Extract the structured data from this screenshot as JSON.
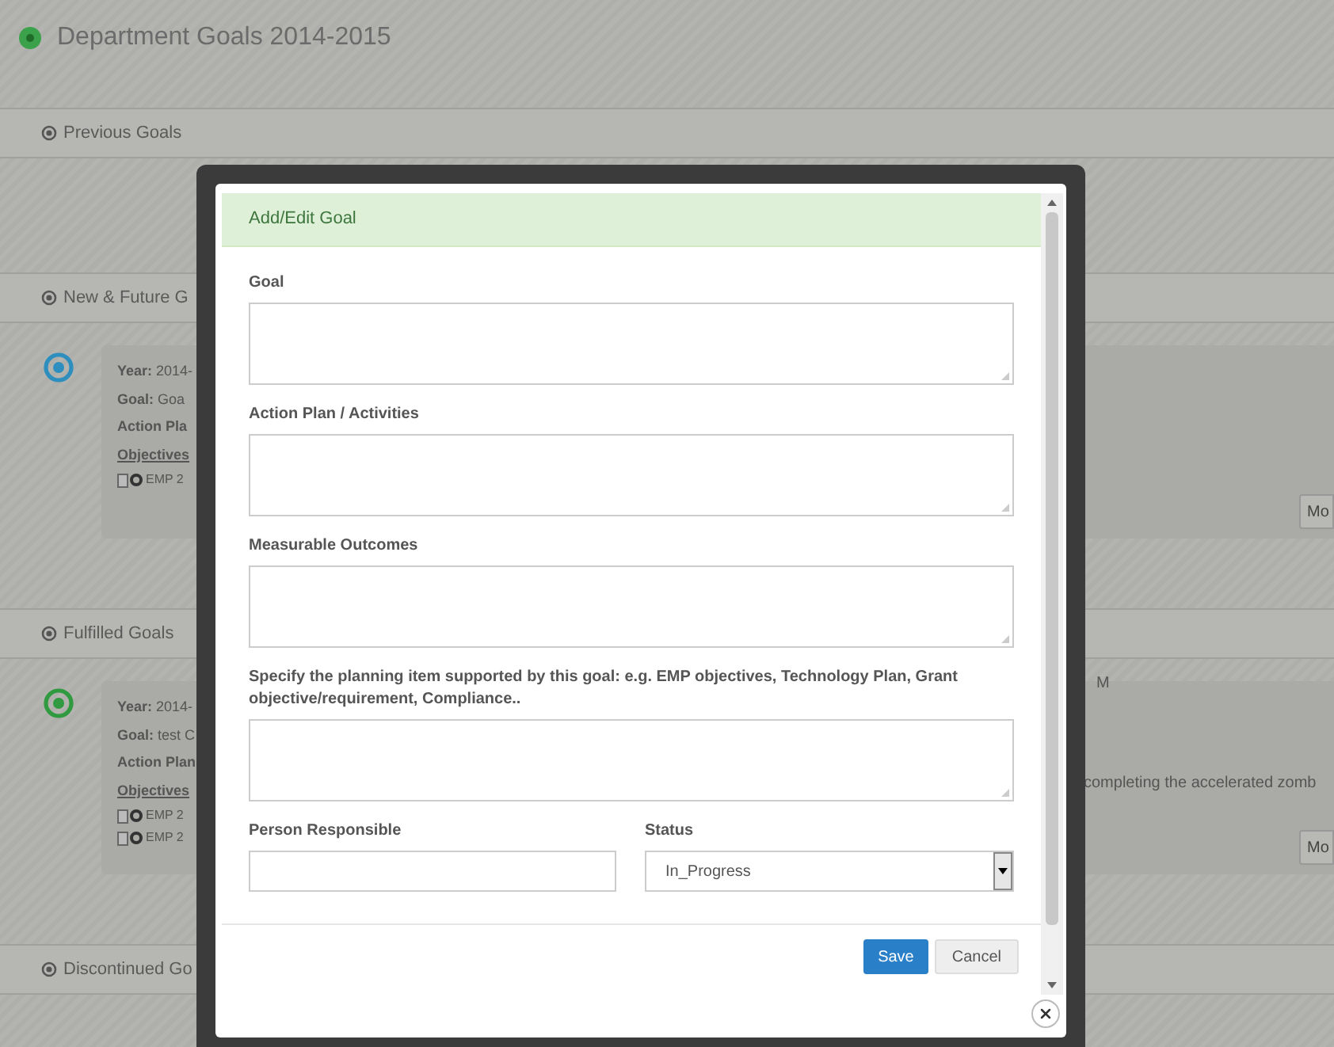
{
  "page_title": "Department Goals 2014-2015",
  "sections": [
    {
      "title": "Previous Goals"
    },
    {
      "title": "New & Future G",
      "goal": {
        "color": "#2e8fbf",
        "lines": [
          "**Year:** 2014-",
          "**Goal:** Goa",
          "**Action Pla**"
        ],
        "objectives_label": "Objectives",
        "objectives": [
          "EMP 2"
        ],
        "more_button": "Mo"
      }
    },
    {
      "title": "Fulfilled Goals",
      "goal": {
        "color": "#2f9a3f",
        "lines": [
          "**Year:** 2014-",
          "**Goal:** test C",
          "**Action Plan**"
        ],
        "objectives_label": "Objectives",
        "objectives": [
          "EMP 2",
          "EMP 2"
        ],
        "side_texts": [
          "M",
          "completing the accelerated zomb"
        ],
        "more_button": "Mo"
      }
    },
    {
      "title": "Discontinued Go"
    }
  ],
  "dialog": {
    "title": "Add/Edit Goal",
    "fields": [
      {
        "kind": "textarea",
        "label": "Goal"
      },
      {
        "kind": "textarea",
        "label": "Action Plan / Activities"
      },
      {
        "kind": "textarea",
        "label": "Measurable Outcomes"
      },
      {
        "kind": "textarea",
        "label": "Specify the planning item supported by this goal: e.g. EMP objectives, Technology Plan, Grant objective/requirement, Compliance.."
      }
    ],
    "row_fields": [
      {
        "kind": "text",
        "label": "Person Responsible"
      },
      {
        "kind": "select",
        "label": "Status",
        "value": "In_Progress"
      }
    ],
    "buttons": [
      {
        "kind": "primary",
        "label": "Save"
      },
      {
        "kind": "default",
        "label": "Cancel"
      }
    ]
  }
}
